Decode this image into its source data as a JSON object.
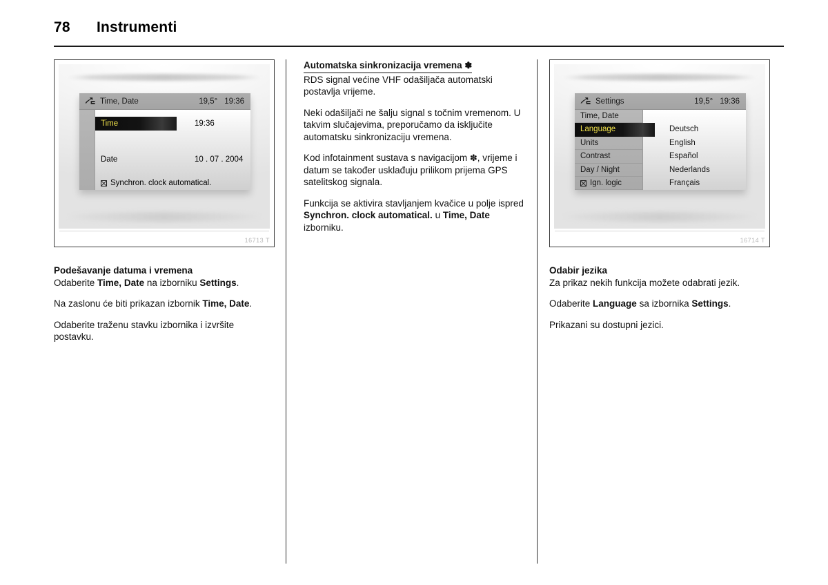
{
  "page": {
    "number": "78",
    "chapter": "Instrumenti"
  },
  "figure_left": {
    "code": "16713 T",
    "display": {
      "icon": "infotainment-settings-icon",
      "title": "Time, Date",
      "temperature": "19,5°",
      "clock": "19:36",
      "rows": [
        {
          "label": "Time",
          "value": "19:36",
          "selected": true
        },
        {
          "label": "Date",
          "value": "10 . 07 . 2004",
          "selected": false
        }
      ],
      "checkbox_item": {
        "label": "Synchron. clock automatical.",
        "checked": true
      }
    }
  },
  "figure_right": {
    "code": "16714 T",
    "display": {
      "icon": "infotainment-settings-icon",
      "title": "Settings",
      "temperature": "19,5°",
      "clock": "19:36",
      "menu_items": [
        {
          "label": "Time, Date",
          "selected": false,
          "checkbox": false
        },
        {
          "label": "Language",
          "selected": true,
          "checkbox": false
        },
        {
          "label": "Units",
          "selected": false,
          "checkbox": false
        },
        {
          "label": "Contrast",
          "selected": false,
          "checkbox": false
        },
        {
          "label": "Day / Night",
          "selected": false,
          "checkbox": false
        },
        {
          "label": "Ign. logic",
          "selected": false,
          "checkbox": true
        }
      ],
      "values": [
        "Deutsch",
        "English",
        "Español",
        "Nederlands",
        "Français"
      ]
    }
  },
  "column_left": {
    "heading": "Podešavanje datuma i vremena",
    "p1_a": "Odaberite ",
    "p1_b": "Time, Date",
    "p1_c": " na izborniku ",
    "p1_d": "Settings",
    "p1_e": ".",
    "p2_a": "Na zaslonu će biti prikazan izbornik ",
    "p2_b": "Time, Date",
    "p2_c": ".",
    "p3": "Odaberite traženu stavku izbornika i izvršite postavku."
  },
  "column_middle": {
    "heading": "Automatska sinkronizacija vremena",
    "heading_symbol": "✽",
    "p1": "RDS signal većine VHF odašiljača automatski postavlja vrijeme.",
    "p2": "Neki odašiljači ne šalju signal s točnim vremenom. U takvim slučajevima, preporučamo da isključite automatsku sinkronizaciju vremena.",
    "p3_a": "Kod infotainment sustava s navigacijom ",
    "p3_symbol": "✽",
    "p3_b": ", vrijeme i datum se također usklađuju prilikom prijema GPS satelitskog signala.",
    "p4_a": "Funkcija se aktivira stavljanjem kvačice u polje ispred ",
    "p4_b": "Synchron. clock automatical.",
    "p4_c": " u ",
    "p4_d": "Time, Date",
    "p4_e": " izborniku."
  },
  "column_right": {
    "heading": "Odabir jezika",
    "p1": "Za prikaz nekih funkcija možete odabrati jezik.",
    "p2_a": "Odaberite ",
    "p2_b": "Language",
    "p2_c": " sa izbornika ",
    "p2_d": "Settings",
    "p2_e": ".",
    "p3": "Prikazani su dostupni jezici."
  },
  "colors": {
    "rule": "#1a1a1a",
    "lcd_highlight_text": "#f2e34a",
    "lcd_highlight_bg": "#111111",
    "lcd_header_bg": "#a8a8a8"
  }
}
